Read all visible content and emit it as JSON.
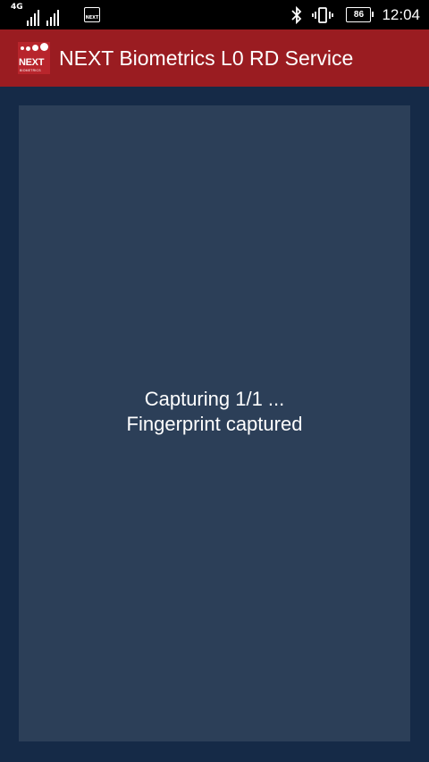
{
  "status_bar": {
    "network_type": "4G",
    "notification_icon_text": "NEXT",
    "battery_level": "86",
    "time": "12:04"
  },
  "app_bar": {
    "logo_text": "NEXT",
    "logo_subtext": "BIOMETRICS",
    "title": "NEXT Biometrics L0 RD Service",
    "background_color": "#9a1c21"
  },
  "capture": {
    "status_line": "Capturing 1/1 ...",
    "result_line": "Fingerprint captured",
    "panel_color": "#2c3f58"
  }
}
